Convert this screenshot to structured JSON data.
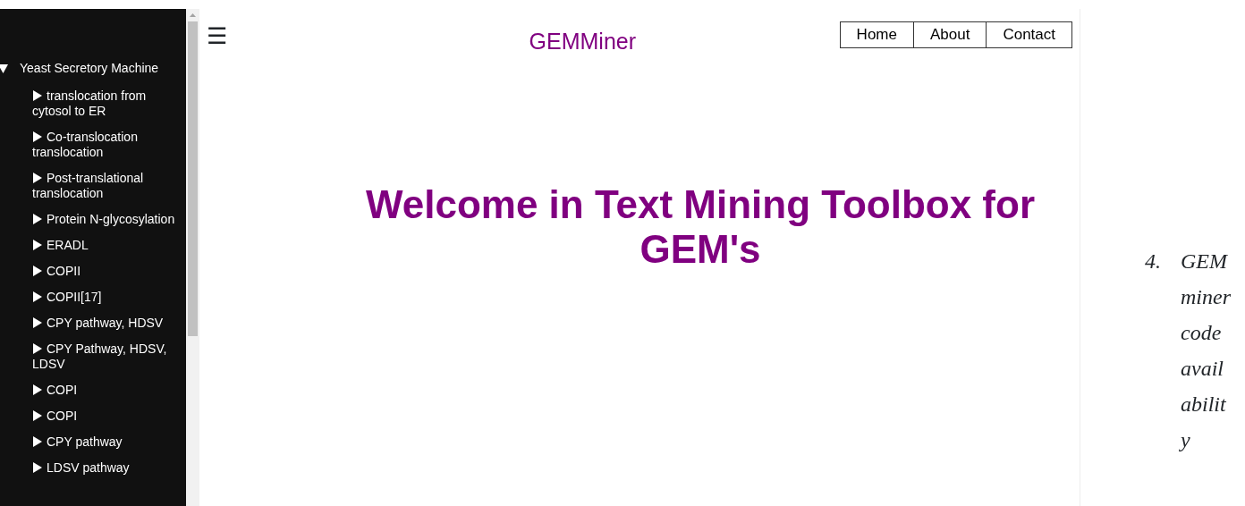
{
  "sidebar": {
    "tree": [
      {
        "label": "Yeast Secretory Machine",
        "expanded": true,
        "children": [
          {
            "label": "translocation from cytosol to ER",
            "expanded": false
          },
          {
            "label": "Co-translocation translocation",
            "expanded": false
          },
          {
            "label": "Post-translational translocation",
            "expanded": false
          },
          {
            "label": "Protein N-glycosylation",
            "expanded": false
          },
          {
            "label": "ERADL",
            "expanded": false
          },
          {
            "label": "COPII",
            "expanded": false
          },
          {
            "label": "COPII[17]",
            "expanded": false
          },
          {
            "label": "CPY pathway, HDSV",
            "expanded": false
          },
          {
            "label": "CPY Pathway, HDSV, LDSV",
            "expanded": false
          },
          {
            "label": "COPI",
            "expanded": false
          },
          {
            "label": "COPI",
            "expanded": false
          },
          {
            "label": "CPY pathway",
            "expanded": false
          },
          {
            "label": "LDSV pathway",
            "expanded": false
          }
        ]
      }
    ]
  },
  "header": {
    "menu_icon": "☰",
    "title": "GEMMiner",
    "nav": [
      "Home",
      "About",
      "Contact"
    ]
  },
  "main": {
    "heading": "Welcome in Text Mining Toolbox for GEM's"
  },
  "aside": {
    "list_item": {
      "number": "4.",
      "text": "GEMminer code availability"
    }
  }
}
